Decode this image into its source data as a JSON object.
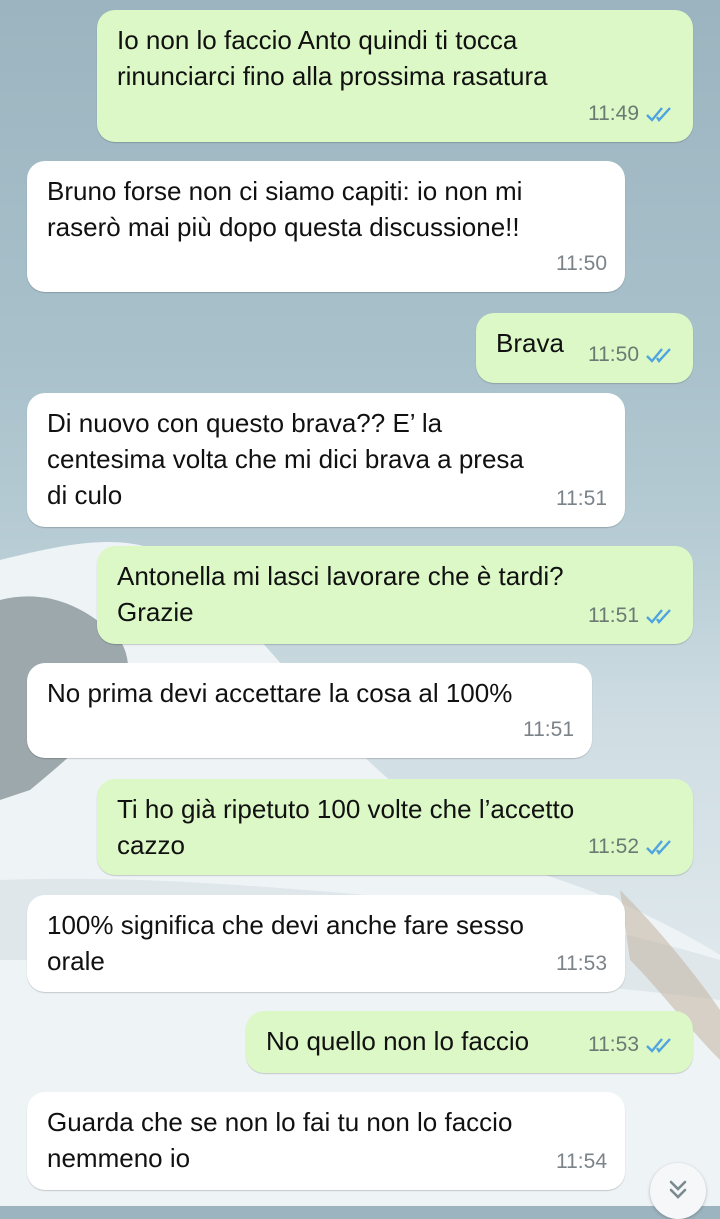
{
  "messages": [
    {
      "dir": "out",
      "text": "Io non lo faccio Anto quindi ti tocca\nrinunciarci fino alla prossima rasatura",
      "time": "11:49",
      "read": true
    },
    {
      "dir": "in",
      "text": "Bruno forse non ci siamo capiti: io non mi\nraserò mai più dopo questa discussione!!",
      "time": "11:50"
    },
    {
      "dir": "out",
      "text": "Brava",
      "time": "11:50",
      "read": true
    },
    {
      "dir": "in",
      "text": "Di nuovo con questo brava?? E’ la\ncentesima volta che mi dici brava a presa\ndi culo",
      "time": "11:51"
    },
    {
      "dir": "out",
      "text": "Antonella mi lasci lavorare che è tardi?\nGrazie",
      "time": "11:51",
      "read": true
    },
    {
      "dir": "in",
      "text": "No prima devi accettare la cosa al 100%",
      "time": "11:51"
    },
    {
      "dir": "out",
      "text": "Ti ho già ripetuto 100 volte che l’accetto\ncazzo",
      "time": "11:52",
      "read": true
    },
    {
      "dir": "in",
      "text": "100% significa che devi anche fare sesso\norale",
      "time": "11:53"
    },
    {
      "dir": "out",
      "text": "No quello non lo faccio",
      "time": "11:53",
      "read": true
    },
    {
      "dir": "in",
      "text": "Guarda che se non lo fai tu non lo faccio\nnemmeno io",
      "time": "11:54"
    }
  ],
  "colors": {
    "outgoing_bubble": "#dcf8c6",
    "incoming_bubble": "#ffffff",
    "read_ticks": "#4fa3e0",
    "time_text": "#6b7a72"
  },
  "icons": {
    "read_receipt": "double-check-icon",
    "scroll_down": "double-chevron-down-icon"
  }
}
